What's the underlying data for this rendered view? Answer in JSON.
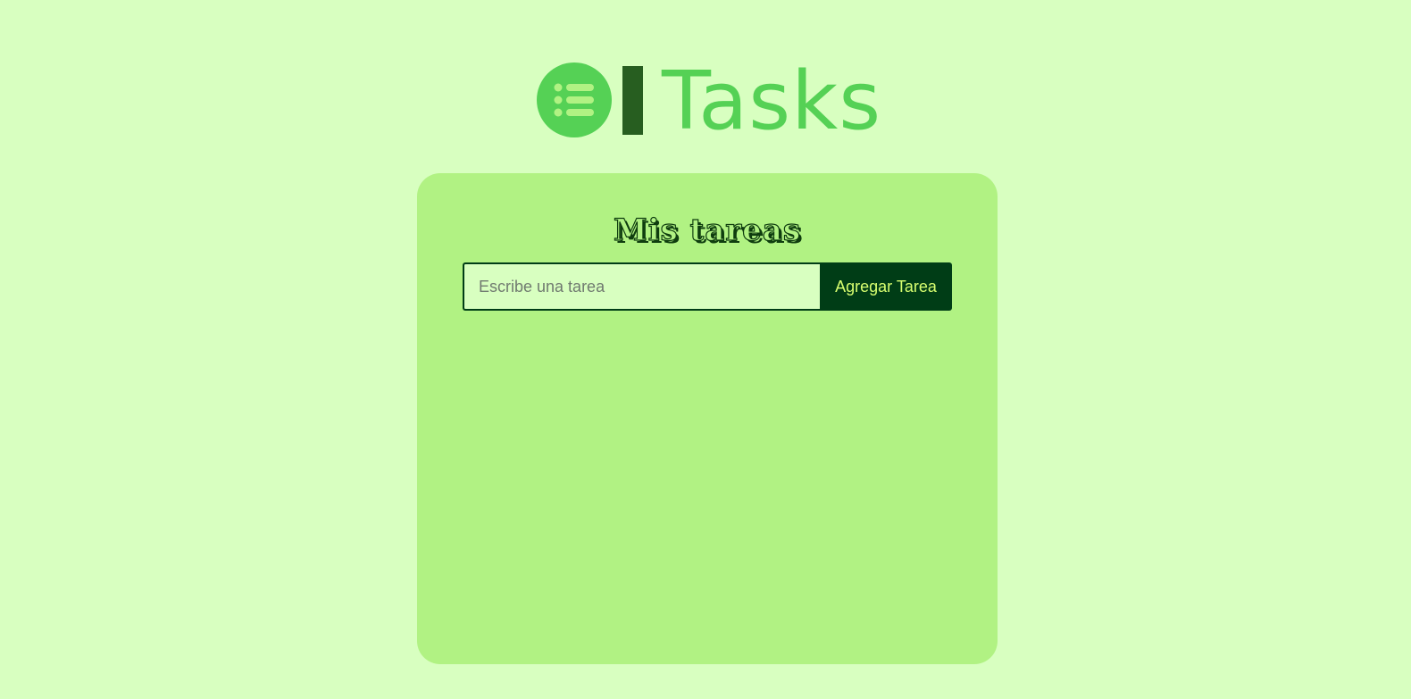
{
  "header": {
    "app_name": "Tasks",
    "logo_icon": "list-icon"
  },
  "colors": {
    "page_background": "#d8ffc0",
    "card_background": "#b1f283",
    "accent_green": "#55d155",
    "logo_bar": "#275e20",
    "button_background": "#003d16",
    "button_text": "#d8ff70"
  },
  "card": {
    "title": "Mis tareas",
    "input": {
      "value": "",
      "placeholder": "Escribe una tarea"
    },
    "add_button_label": "Agregar Tarea",
    "tasks": []
  }
}
